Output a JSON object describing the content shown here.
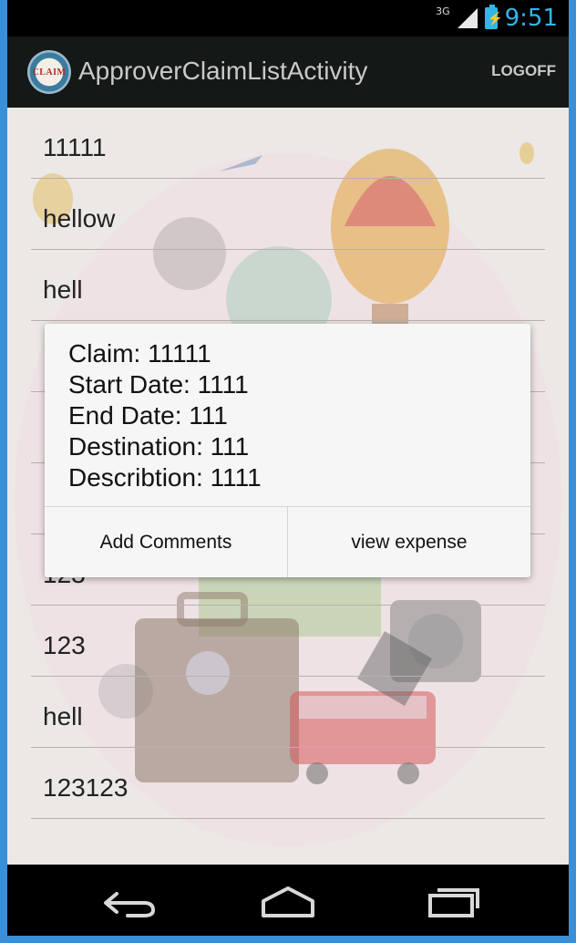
{
  "status_bar": {
    "network": "3G",
    "time": "9:51"
  },
  "action_bar": {
    "logo_text": "CLAIM",
    "title": "ApproverClaimListActivity",
    "logoff": "LOGOFF"
  },
  "list": {
    "items": [
      "11111",
      "hellow",
      "hell",
      "",
      "",
      "",
      "123",
      "123",
      "hell",
      "123123"
    ]
  },
  "dialog": {
    "lines": [
      "Claim: 11111",
      "Start Date: 1111",
      "End Date: 111",
      "Destination: 111",
      "Describtion: 1111"
    ],
    "buttons": {
      "left": "Add Comments",
      "right": "view expense"
    }
  },
  "nav": {
    "icons": [
      "back-icon",
      "home-icon",
      "recents-icon"
    ]
  },
  "colors": {
    "accent": "#33b5e5",
    "action_bar": "#141817",
    "frame": "#3b8fd6"
  }
}
